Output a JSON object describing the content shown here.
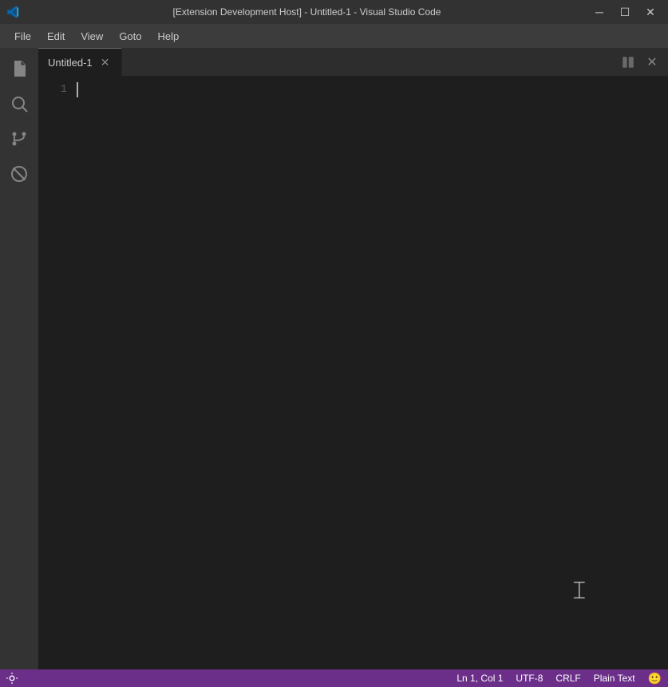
{
  "titlebar": {
    "title": "[Extension Development Host] - Untitled-1 - Visual Studio Code",
    "minimize_label": "─",
    "maximize_label": "☐",
    "close_label": "✕"
  },
  "menubar": {
    "items": [
      {
        "label": "File"
      },
      {
        "label": "Edit"
      },
      {
        "label": "View"
      },
      {
        "label": "Goto"
      },
      {
        "label": "Help"
      }
    ]
  },
  "activity_bar": {
    "icons": [
      {
        "name": "explorer-icon",
        "tooltip": "Explorer"
      },
      {
        "name": "search-icon",
        "tooltip": "Search"
      },
      {
        "name": "source-control-icon",
        "tooltip": "Source Control"
      },
      {
        "name": "extensions-icon",
        "tooltip": "Extensions"
      }
    ]
  },
  "editor": {
    "tab_label": "Untitled-1",
    "line_number": "1"
  },
  "statusbar": {
    "position": "Ln 1, Col 1",
    "encoding": "UTF-8",
    "line_ending": "CRLF",
    "language": "Plain Text",
    "smiley": "🙂"
  }
}
